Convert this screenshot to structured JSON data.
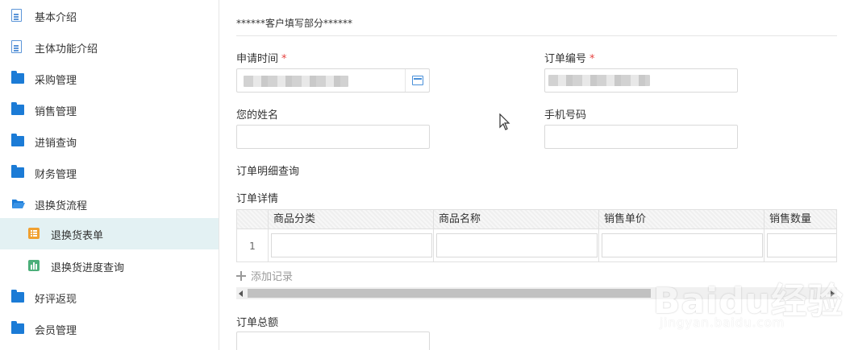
{
  "sidebar": {
    "items": [
      {
        "label": "基本介绍",
        "icon": "document-icon"
      },
      {
        "label": "主体功能介绍",
        "icon": "document-icon"
      },
      {
        "label": "采购管理",
        "icon": "folder-icon"
      },
      {
        "label": "销售管理",
        "icon": "folder-icon"
      },
      {
        "label": "进销查询",
        "icon": "folder-icon"
      },
      {
        "label": "财务管理",
        "icon": "folder-icon"
      },
      {
        "label": "退换货流程",
        "icon": "folder-open-icon"
      },
      {
        "label": "退换货表单",
        "icon": "form-icon"
      },
      {
        "label": "退换货进度查询",
        "icon": "bar-chart-icon"
      },
      {
        "label": "好评返现",
        "icon": "folder-icon"
      },
      {
        "label": "会员管理",
        "icon": "folder-icon"
      }
    ],
    "active_item": "退换货表单"
  },
  "form": {
    "section_title": "******客户填写部分******",
    "apply_time_label": "申请时间",
    "order_no_label": "订单编号",
    "required_mark": "*",
    "name_label": "您的姓名",
    "phone_label": "手机号码",
    "order_detail_query_label": "订单明细查询",
    "order_detail_label": "订单详情",
    "table": {
      "columns": [
        "商品分类",
        "商品名称",
        "销售单价",
        "销售数量"
      ],
      "rows": [
        {
          "index": "1"
        }
      ]
    },
    "add_record_label": "添加记录",
    "order_total_label": "订单总额"
  },
  "watermark": {
    "main": "Baidu经验",
    "sub": "jingyan.baidu.com"
  },
  "colors": {
    "accent": "#1b7bd6",
    "active_bg": "#e3f1f3",
    "required": "#e64340"
  }
}
